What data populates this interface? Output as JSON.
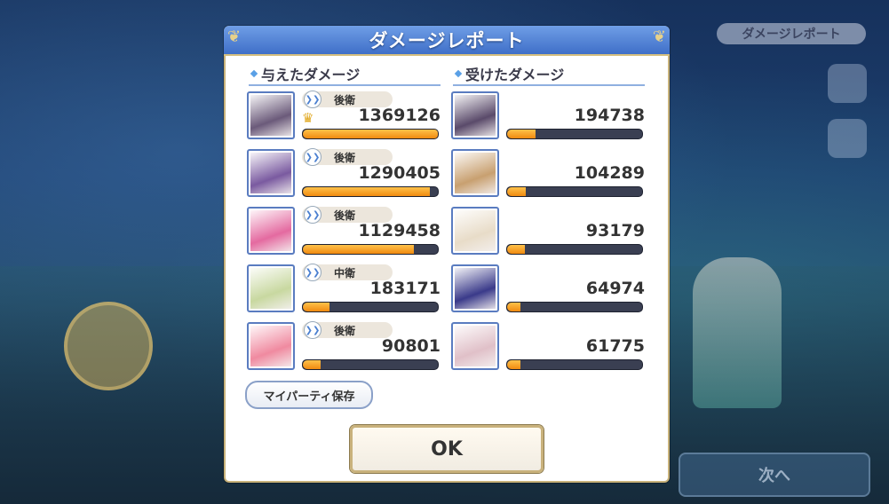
{
  "background": {
    "report_chip": "ダメージレポート",
    "next_button": "次へ"
  },
  "dialog": {
    "title": "ダメージレポート",
    "dealt_header": "与えたダメージ",
    "taken_header": "受けたダメージ",
    "dealt": [
      {
        "role": "後衛",
        "damage": "1369126",
        "fill": 1.0,
        "top": true,
        "portrait_color": "#6b5a7a"
      },
      {
        "role": "後衛",
        "damage": "1290405",
        "fill": 0.94,
        "top": false,
        "portrait_color": "#7a5aa0"
      },
      {
        "role": "後衛",
        "damage": "1129458",
        "fill": 0.82,
        "top": false,
        "portrait_color": "#e46aa0"
      },
      {
        "role": "中衛",
        "damage": "183171",
        "fill": 0.2,
        "top": false,
        "portrait_color": "#c8d8a0"
      },
      {
        "role": "後衛",
        "damage": "90801",
        "fill": 0.13,
        "top": false,
        "portrait_color": "#f08aa0"
      }
    ],
    "taken": [
      {
        "damage": "194738",
        "fill": 0.21,
        "portrait_color": "#5a4a6a"
      },
      {
        "damage": "104289",
        "fill": 0.14,
        "portrait_color": "#c8a070"
      },
      {
        "damage": "93179",
        "fill": 0.13,
        "portrait_color": "#e8dcc8"
      },
      {
        "damage": "64974",
        "fill": 0.1,
        "portrait_color": "#3a3a8a"
      },
      {
        "damage": "61775",
        "fill": 0.1,
        "portrait_color": "#e0c0c8"
      }
    ],
    "save_party_label": "マイパーティ保存",
    "ok_label": "OK"
  },
  "colors": {
    "bar_fill": "#f5a623",
    "header_blue": "#4f7fd6",
    "frame_gold": "#c8b27a"
  }
}
